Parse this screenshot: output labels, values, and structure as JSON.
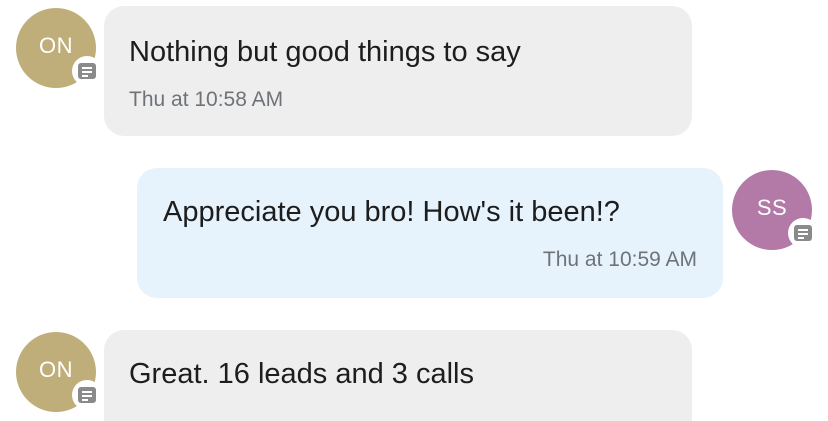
{
  "messages": [
    {
      "sender_initials": "ON",
      "direction": "incoming",
      "text": "Nothing but good things to say",
      "timestamp": "Thu at 10:58 AM"
    },
    {
      "sender_initials": "SS",
      "direction": "outgoing",
      "text": "Appreciate you bro! How's it been!?",
      "timestamp": "Thu at 10:59 AM"
    },
    {
      "sender_initials": "ON",
      "direction": "incoming",
      "text": "Great. 16 leads and 3 calls",
      "timestamp": ""
    }
  ],
  "icons": {
    "avatar_badge": "message-icon"
  },
  "colors": {
    "avatar_on": "#bfae79",
    "avatar_ss": "#b37aa8",
    "incoming_bubble": "#eeeeee",
    "outgoing_bubble": "#e6f3fd"
  }
}
